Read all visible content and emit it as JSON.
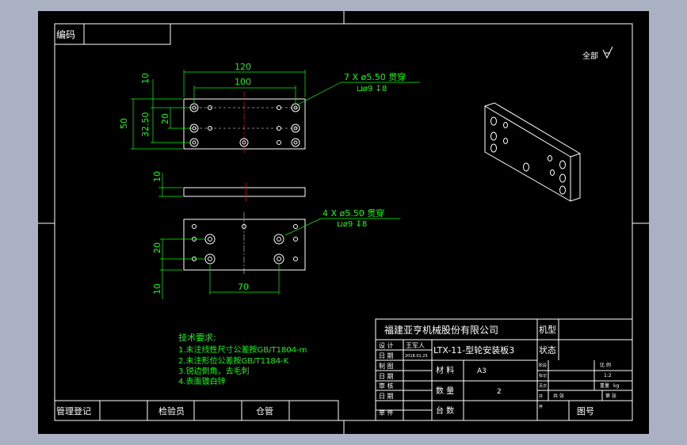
{
  "colors": {
    "background": "#a9b1c2",
    "sheet": "#000000",
    "frame": "#ffffff",
    "part": "#ffffff",
    "dimension": "#00ff00",
    "centerline": "#ff0000",
    "text": "#ffffff",
    "text_green": "#00ff00"
  },
  "header": {
    "code_label": "编码"
  },
  "surface_finish": {
    "label": "全部",
    "icon": "surface-roughness-icon"
  },
  "top_view": {
    "dim_length_120": "120",
    "dim_length_100": "100",
    "dim_height_50": "50",
    "dim_height_32_50": "32.50",
    "dim_height_20": "20",
    "dim_edge_10": "10",
    "hole_callout_line1": "7 X ø5.50 贯穿",
    "hole_callout_line2": "⊔ø9 ↧8"
  },
  "side_view": {
    "dim_thickness_10": "10"
  },
  "bottom_view": {
    "hole_callout_line1": "4 X ø5.50 贯穿",
    "hole_callout_line2": "⊔ø9 ↧8",
    "dim_height_20": "20",
    "dim_edge_10": "10",
    "dim_spacing_70": "70"
  },
  "tech_requirements": {
    "title": "技术要求:",
    "items": [
      "1.未注线性尺寸公差按GB/T1804-m",
      "2.未注形位公差按GB/T1184-K",
      "3.锐边倒角，去毛刺",
      "4.表面镀白锌"
    ]
  },
  "bottom_bar": {
    "management": "管理登记",
    "inspector": "检验员",
    "position": "仓管"
  },
  "title_block": {
    "company": "福建亚亨机械股份有限公司",
    "machine_label": "机型",
    "status_label": "状态",
    "design_label": "设 计",
    "design_value": "王军人",
    "date_label": "日 期",
    "date_value": "2018.01.25",
    "part_name": "LTX-11-型轮安装板3",
    "draw_label": "制 图",
    "date_label_2": "日 期",
    "check_label": "审 核",
    "date_label_3": "日 期",
    "material_label": "材 料",
    "material_value": "A3",
    "quantity_label": "数 量",
    "quantity_value": "2",
    "unit_label": "单 件",
    "sets_label": "台 数",
    "drawing_number_label": "图号",
    "scale_label": "比 例",
    "scale_value": "1:2",
    "weight_label": "重量",
    "weight_value": "kg",
    "sheet_label_1": "共 张",
    "sheet_label_2": "第 张",
    "stage_labels": [
      "阶段",
      "标记",
      "页次",
      "共",
      "序"
    ]
  }
}
